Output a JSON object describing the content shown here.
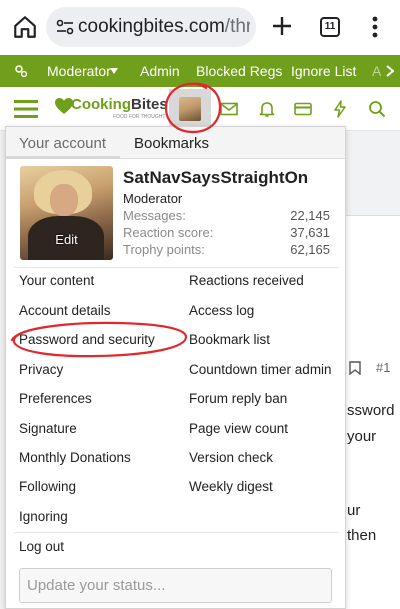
{
  "browser": {
    "url_main": "cookingbites.com",
    "url_rest": "/thr",
    "tab_count": "11"
  },
  "modbar": {
    "items": [
      "Moderator",
      "Admin",
      "Blocked Regs",
      "Ignore List",
      "A"
    ]
  },
  "logo": {
    "brand_green": "Cooking",
    "brand_dark": "Bites",
    "tagline": "FOOD FOR THOUGHT"
  },
  "background_text": {
    "line1": "ssword",
    "line2": "your",
    "line3": "ur",
    "line4": "then",
    "post_number": "#1"
  },
  "menu": {
    "tabs": [
      "Your account",
      "Bookmarks"
    ],
    "profile": {
      "edit_label": "Edit",
      "username": "SatNavSaysStraightOn",
      "role": "Moderator",
      "stats": [
        {
          "label": "Messages:",
          "value": "22,145"
        },
        {
          "label": "Reaction score:",
          "value": "37,631"
        },
        {
          "label": "Trophy points:",
          "value": "62,165"
        }
      ]
    },
    "links_left": [
      "Your content",
      "Account details",
      "Password and security",
      "Privacy",
      "Preferences",
      "Signature",
      "Monthly Donations",
      "Following",
      "Ignoring"
    ],
    "links_right": [
      "Reactions received",
      "Access log",
      "Bookmark list",
      "Countdown timer admin",
      "Forum reply ban",
      "Page view count",
      "Version check",
      "Weekly digest"
    ],
    "logout": "Log out",
    "status_placeholder": "Update your status..."
  },
  "colors": {
    "brand_green": "#6f9f1b",
    "annotation_red": "#e0282e"
  }
}
